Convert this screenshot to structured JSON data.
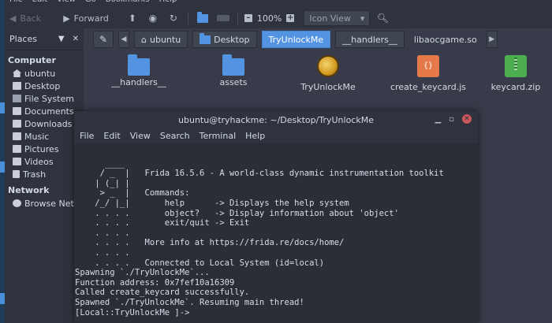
{
  "menubar": [
    "File",
    "Edit",
    "View",
    "Go",
    "Bookmarks",
    "Help"
  ],
  "toolbar": {
    "back": "Back",
    "forward": "Forward",
    "zoom": "100%",
    "view": "Icon View"
  },
  "sidebar": {
    "title": "Places",
    "sections": [
      {
        "label": "Computer",
        "items": [
          {
            "label": "ubuntu",
            "icon": "home-icon"
          },
          {
            "label": "Desktop",
            "icon": "desktop-icon"
          },
          {
            "label": "File System",
            "icon": "drive-icon"
          },
          {
            "label": "Documents",
            "icon": "folder-icon"
          },
          {
            "label": "Downloads",
            "icon": "download-icon"
          },
          {
            "label": "Music",
            "icon": "music-icon"
          },
          {
            "label": "Pictures",
            "icon": "pictures-icon"
          },
          {
            "label": "Videos",
            "icon": "videos-icon"
          },
          {
            "label": "Trash",
            "icon": "trash-icon"
          }
        ]
      },
      {
        "label": "Network",
        "items": [
          {
            "label": "Browse Netw",
            "icon": "network-icon"
          }
        ]
      }
    ]
  },
  "breadcrumb": [
    "ubuntu",
    "Desktop",
    "TryUnlockMe",
    "__handlers__",
    "libaocgame.so"
  ],
  "files": [
    {
      "name": "__handlers__",
      "icon": "folder-icon"
    },
    {
      "name": "assets",
      "icon": "folder-icon"
    },
    {
      "name": "TryUnlockMe",
      "icon": "game-icon"
    },
    {
      "name": "create_keycard.js",
      "icon": "js-file-icon"
    },
    {
      "name": "keycard.zip",
      "icon": "zip-icon"
    }
  ],
  "terminal": {
    "title": "ubuntu@tryhackme: ~/Desktop/TryUnlockMe",
    "menu": [
      "File",
      "Edit",
      "View",
      "Search",
      "Terminal",
      "Help"
    ],
    "lines": [
      "      ____",
      "     / _  |   Frida 16.5.6 - A world-class dynamic instrumentation toolkit",
      "    | (_| |",
      "     > _  |   Commands:",
      "    /_/ |_|       help      -> Displays the help system",
      "    . . . .       object?   -> Display information about 'object'",
      "    . . . .       exit/quit -> Exit",
      "    . . . .",
      "    . . . .   More info at https://frida.re/docs/home/",
      "    . . . .",
      "    . . . .   Connected to Local System (id=local)",
      "Spawning `./TryUnlockMe`...",
      "Function address: 0x7fef10a16309",
      "Called create_keycard successfully.",
      "Spawned `./TryUnlockMe`. Resuming main thread!",
      "[Local::TryUnlockMe ]->"
    ]
  },
  "colors": {
    "accent": "#5294e2",
    "close": "#cc575d"
  }
}
